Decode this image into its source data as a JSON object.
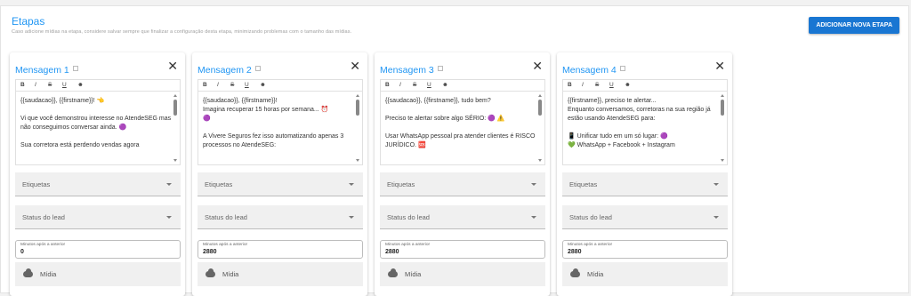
{
  "header": {
    "title": "Etapas",
    "subtitle": "Caso adicione mídias na etapa, considere salvar sempre que finalizar a configuração desta etapa, minimizando problemas com o tamanho das mídias.",
    "add_button": "ADICIONAR NOVA ETAPA"
  },
  "labels": {
    "tags": "Etiquetas",
    "lead_status": "Status do lead",
    "minutes_label": "Minutos após a anterior",
    "media": "Mídia"
  },
  "toolbar": {
    "bold": "B",
    "italic": "I",
    "strike": "S",
    "underline": "U",
    "emoji": "☻"
  },
  "cards": [
    {
      "title": "Mensagem 1",
      "minutes": "0",
      "text": "{{saudacao}}, {{firstname}}! 👈\n\nVi que você demonstrou interesse no AtendeSEG mas não conseguimos conversar ainda. 🟣\n\nSua corretora está perdendo vendas agora"
    },
    {
      "title": "Mensagem 2",
      "minutes": "2880",
      "text": "{{saudacao}}, {{firstname}}!\nImagina recuperar 15 horas por semana... ⏰\n🟣\n\nA Vivere Seguros fez isso automatizando apenas 3 processos no AtendeSEG:"
    },
    {
      "title": "Mensagem 3",
      "minutes": "2880",
      "text": "{{saudacao}}, {{firstname}}, tudo bem?\n\nPreciso te alertar sobre algo SÉRIO: 🟣 ⚠️\n\nUsar WhatsApp pessoal pra atender clientes é RISCO JURÍDICO. 🆘"
    },
    {
      "title": "Mensagem 4",
      "minutes": "2880",
      "text": "{{firstname}}, preciso te alertar...\nEnquanto conversamos, corretoras na sua região já estão usando AtendeSEG para:\n\n📱 Unificar tudo em um só lugar: 🟣\n💚 WhatsApp + Facebook + Instagram"
    }
  ]
}
